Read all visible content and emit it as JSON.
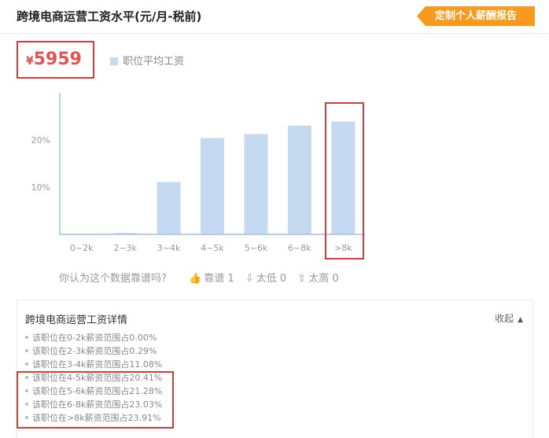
{
  "header": {
    "title": "跨境电商运营工资水平(元/月-税前)",
    "report_button": "定制个人薪酬报告"
  },
  "salary": {
    "currency": "¥",
    "value": "5959",
    "legend": "职位平均工资"
  },
  "chart_data": {
    "type": "bar",
    "categories": [
      "0~2k",
      "2~3k",
      "3~4k",
      "4~5k",
      "5~6k",
      "6~8k",
      ">8k"
    ],
    "values": [
      0.0,
      0.29,
      11.08,
      20.41,
      21.28,
      23.03,
      23.91
    ],
    "ytick_labels": [
      "10%",
      "20%"
    ],
    "ytick_values": [
      10,
      20
    ],
    "ylim": [
      0,
      30
    ],
    "bar_color": "#c5daf0",
    "axis_color": "#9ec1e4",
    "tick_label_color": "#999999"
  },
  "feedback": {
    "question": "你认为这个数据靠谱吗?",
    "reliable": {
      "label": "靠谱",
      "count": "1"
    },
    "too_low": {
      "label": "太低",
      "count": "0"
    },
    "too_high": {
      "label": "太高",
      "count": "0"
    }
  },
  "detail": {
    "title": "跨境电商运营工资详情",
    "collapse": "收起",
    "items": [
      "该职位在0-2k薪资范围占0.00%",
      "该职位在2-3k薪资范围占0.29%",
      "该职位在3-4k薪资范围占11.08%",
      "该职位在4-5k薪资范围占20.41%",
      "该职位在5-6k薪资范围占21.28%",
      "该职位在6-8k薪资范围占23.03%",
      "该职位在>8k薪资范围占23.91%"
    ]
  },
  "colors": {
    "accent": "#f79a1e",
    "salary": "#e55252",
    "highlight": "#d93a3a"
  }
}
